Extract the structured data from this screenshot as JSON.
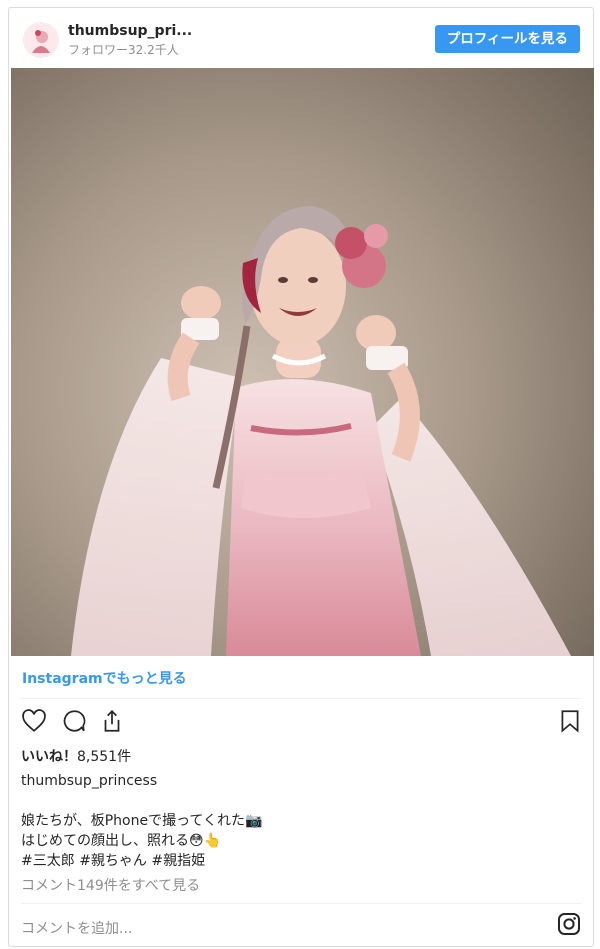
{
  "header": {
    "username": "thumbsup_pri...",
    "followers": "フォロワー32.2千人",
    "profile_button": "プロフィールを見る"
  },
  "post": {
    "more_link": "Instagramでもっと見る",
    "likes_prefix": "いいね！",
    "likes_count": "8,551件",
    "owner": "thumbsup_princess",
    "caption_line1": "娘たちが、板Phoneで撮ってくれた📷",
    "caption_line2": "はじめての顔出し、照れる😳👆",
    "hashtags": [
      "#三太郎",
      "#親ちゃん",
      "#親指姫"
    ],
    "view_comments": "コメント149件をすべて見る",
    "add_comment_placeholder": "コメントを追加..."
  },
  "icons": {
    "like": "heart-icon",
    "comment": "comment-icon",
    "share": "share-icon",
    "save": "bookmark-icon",
    "instagram": "instagram-logo-icon"
  },
  "colors": {
    "accent": "#3897f0",
    "muted": "#8e8e8e",
    "text": "#262626"
  }
}
